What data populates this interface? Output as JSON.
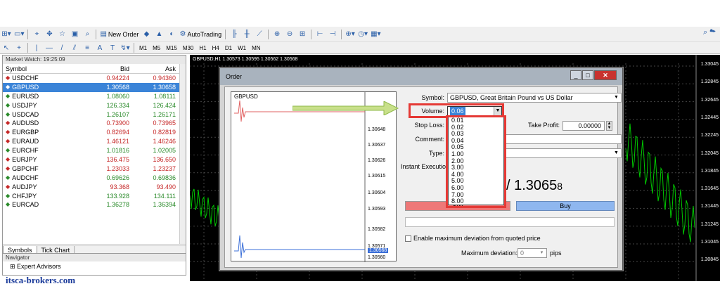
{
  "toolbar1": {
    "new_order": "New Order",
    "autotrading": "AutoTrading"
  },
  "toolbar2": {
    "timeframes": [
      "M1",
      "M5",
      "M15",
      "M30",
      "H1",
      "H4",
      "D1",
      "W1",
      "MN"
    ]
  },
  "market_watch": {
    "title": "Market Watch: 19:25:09",
    "headers": {
      "symbol": "Symbol",
      "bid": "Bid",
      "ask": "Ask"
    },
    "rows": [
      {
        "symbol": "USDCHF",
        "bid": "0.94224",
        "ask": "0.94360",
        "dir": "dn"
      },
      {
        "symbol": "GBPUSD",
        "bid": "1.30568",
        "ask": "1.30658",
        "dir": "dn",
        "selected": true
      },
      {
        "symbol": "EURUSD",
        "bid": "1.08060",
        "ask": "1.08111",
        "dir": "up"
      },
      {
        "symbol": "USDJPY",
        "bid": "126.334",
        "ask": "126.424",
        "dir": "up"
      },
      {
        "symbol": "USDCAD",
        "bid": "1.26107",
        "ask": "1.26171",
        "dir": "up"
      },
      {
        "symbol": "AUDUSD",
        "bid": "0.73900",
        "ask": "0.73965",
        "dir": "dn"
      },
      {
        "symbol": "EURGBP",
        "bid": "0.82694",
        "ask": "0.82819",
        "dir": "dn"
      },
      {
        "symbol": "EURAUD",
        "bid": "1.46121",
        "ask": "1.46246",
        "dir": "dn"
      },
      {
        "symbol": "EURCHF",
        "bid": "1.01816",
        "ask": "1.02005",
        "dir": "up"
      },
      {
        "symbol": "EURJPY",
        "bid": "136.475",
        "ask": "136.650",
        "dir": "dn"
      },
      {
        "symbol": "GBPCHF",
        "bid": "1.23033",
        "ask": "1.23237",
        "dir": "dn"
      },
      {
        "symbol": "AUDCHF",
        "bid": "0.69626",
        "ask": "0.69836",
        "dir": "up"
      },
      {
        "symbol": "AUDJPY",
        "bid": "93.368",
        "ask": "93.490",
        "dir": "dn"
      },
      {
        "symbol": "CHFJPY",
        "bid": "133.928",
        "ask": "134.111",
        "dir": "up"
      },
      {
        "symbol": "EURCAD",
        "bid": "1.36278",
        "ask": "1.36394",
        "dir": "up"
      }
    ],
    "tabs": [
      "Symbols",
      "Tick Chart"
    ]
  },
  "navigator": {
    "title": "Navigator",
    "item": "Expert Advisors"
  },
  "watermark": "itsca-brokers.com",
  "chart": {
    "title": "GBPUSD,H1  1.30573 1.30595 1.30562 1.30568",
    "price_axis": [
      "1.33045",
      "1.32845",
      "1.32645",
      "1.32445",
      "1.32245",
      "1.32045",
      "1.31845",
      "1.31645",
      "1.31445",
      "1.31245",
      "1.31045",
      "1.30845"
    ]
  },
  "order": {
    "title": "Order",
    "mini_chart": {
      "title": "GBPUSD",
      "prices": [
        "1.30648",
        "1.30637",
        "1.30626",
        "1.30615",
        "1.30604",
        "1.30593",
        "1.30582",
        "1.30571",
        "1.30568",
        "1.30560"
      ]
    },
    "symbol_label": "Symbol:",
    "symbol_value": "GBPUSD, Great Britain Pound vs US Dollar",
    "volume_label": "Volume:",
    "volume_value": "0.06",
    "volume_options": [
      "0.01",
      "0.02",
      "0.03",
      "0.04",
      "0.05",
      "1.00",
      "2.00",
      "3.00",
      "4.00",
      "5.00",
      "6.00",
      "7.00",
      "8.00"
    ],
    "stoploss_label": "Stop Loss:",
    "takeprofit_label": "Take Profit:",
    "takeprofit_value": "0.00000",
    "comment_label": "Comment:",
    "type_label": "Type:",
    "exec_label": "Instant Executio",
    "price_display": "/ 1.3065",
    "price_small": "8",
    "sell_label": "Sell",
    "buy_label": "Buy",
    "deviation_check": "Enable maximum deviation from quoted price",
    "deviation_label": "Maximum deviation:",
    "deviation_value": "0",
    "pips": "pips"
  }
}
